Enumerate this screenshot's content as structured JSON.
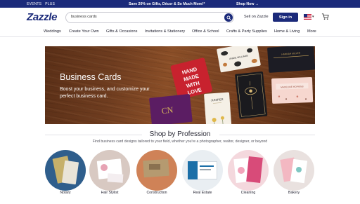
{
  "promo": {
    "left_links": [
      "EVENTS",
      "PLUS"
    ],
    "message": "Save 20% on Gifts, Décor & So Much More!*",
    "cta": "Shop Now →"
  },
  "header": {
    "logo": "Zazzle",
    "search": {
      "value": "business cards",
      "placeholder": ""
    },
    "sell_link": "Sell on Zazzle",
    "signin_label": "Sign in",
    "locale_icon": "us-flag-icon",
    "cart_icon": "cart-icon"
  },
  "nav": {
    "items": [
      "Weddings",
      "Create Your Own",
      "Gifts & Occasions",
      "Invitations & Stationery",
      "Office & School",
      "Crafts & Party Supplies",
      "Home & Living",
      "More"
    ]
  },
  "hero": {
    "title": "Business Cards",
    "subtitle": "Boost your business, and customize your perfect business card.",
    "card_texts": {
      "hand_made": "HAND MADE WITH LOVE",
      "juniper": "JUNIPER",
      "angie": "ANGIE WILLIAMS",
      "madeline": "MADELINE HOPKINS",
      "hannah": "HANNAH MILLER",
      "monogram": "CN"
    }
  },
  "profession": {
    "title": "Shop by Profession",
    "subtitle": "Find business card designs tailored to your field, whether you're a photographer, realtor, designer, or beyond",
    "categories": [
      {
        "label": "Notary"
      },
      {
        "label": "Hair Stylist"
      },
      {
        "label": "Construction"
      },
      {
        "label": "Real Estate"
      },
      {
        "label": "Cleaning"
      },
      {
        "label": "Bakery"
      }
    ]
  },
  "colors": {
    "brand_navy": "#1b2a7a",
    "promo_bg": "#1b2a7a",
    "hero_wood": "#6e3c1f"
  }
}
